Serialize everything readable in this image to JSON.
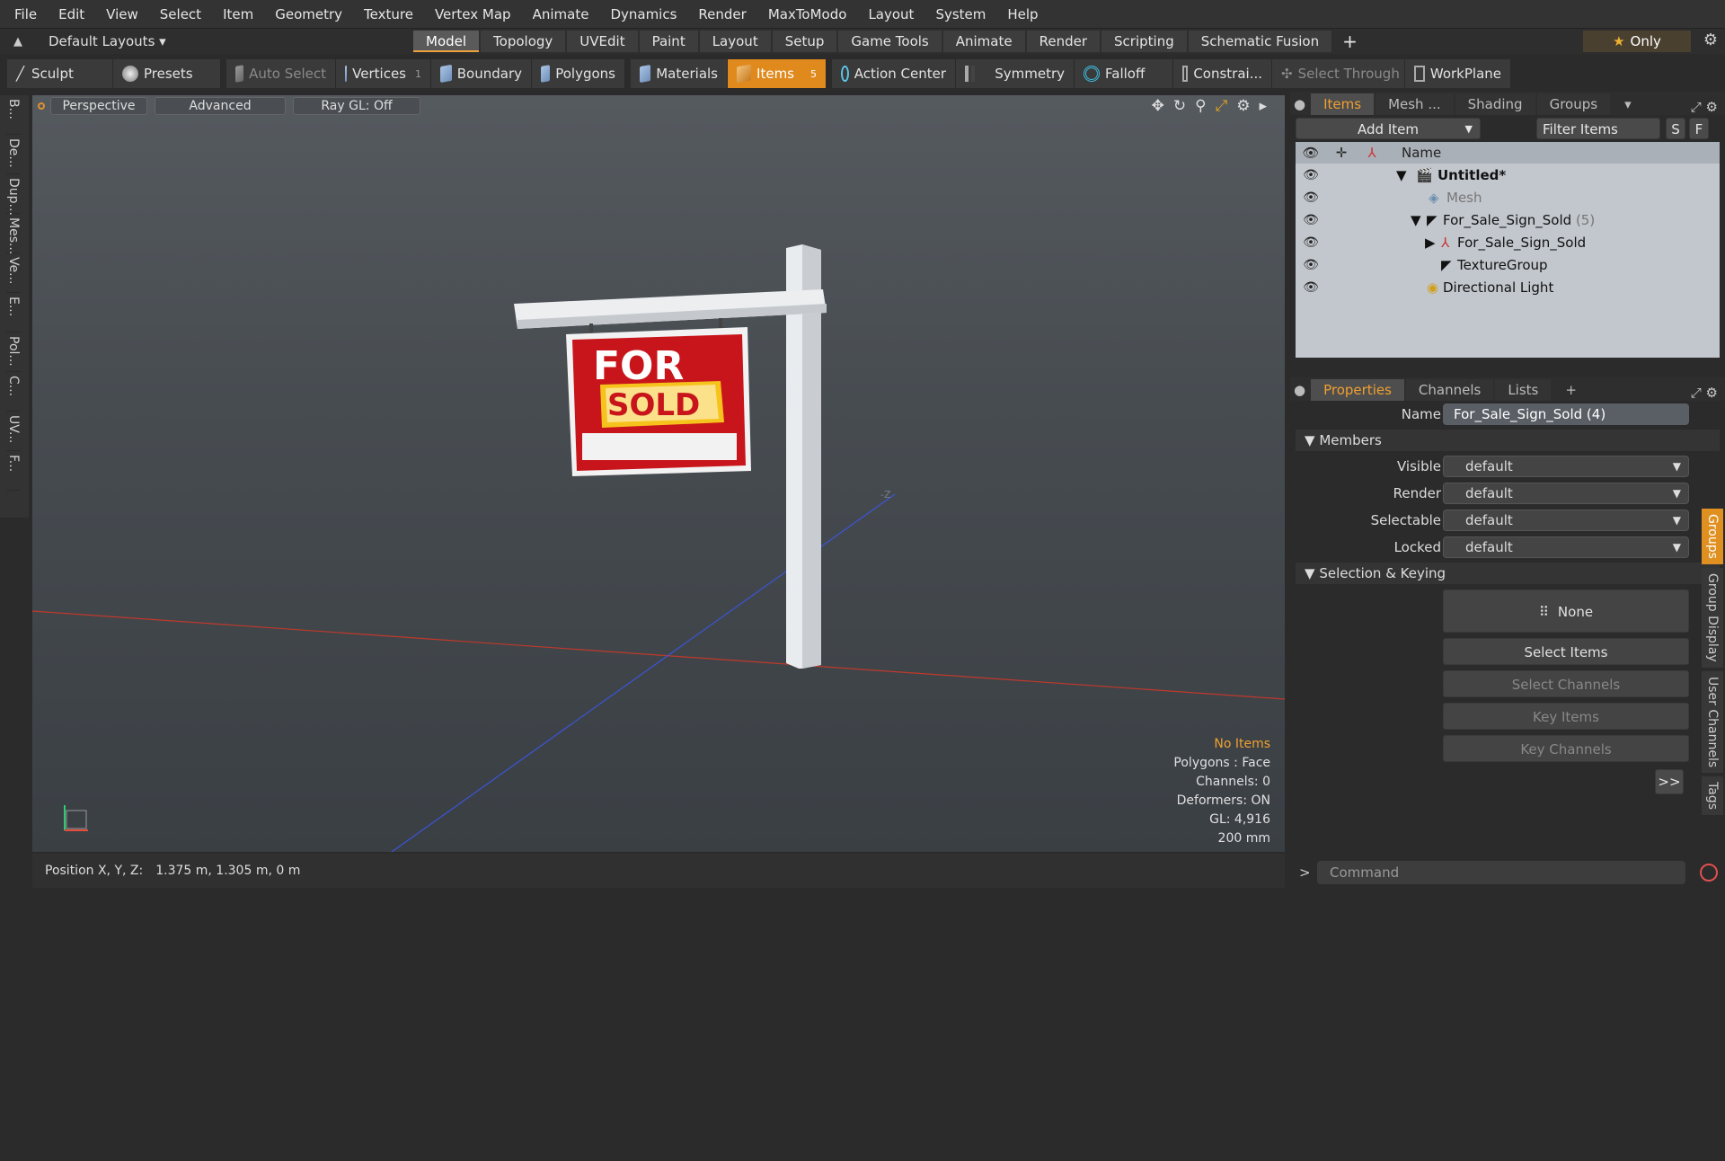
{
  "menu": [
    "File",
    "Edit",
    "View",
    "Select",
    "Item",
    "Geometry",
    "Texture",
    "Vertex Map",
    "Animate",
    "Dynamics",
    "Render",
    "MaxToModo",
    "Layout",
    "System",
    "Help"
  ],
  "layout": {
    "default_layouts": "Default Layouts ▾",
    "tabs": [
      "Model",
      "Topology",
      "UVEdit",
      "Paint",
      "Layout",
      "Setup",
      "Game Tools",
      "Animate",
      "Render",
      "Scripting",
      "Schematic Fusion"
    ],
    "active_tab": "Model",
    "only_label": "Only"
  },
  "toolbar": {
    "sculpt": "Sculpt",
    "presets": "Presets",
    "auto_select": "Auto Select",
    "vertices": "Vertices",
    "vertices_count": "1",
    "boundary": "Boundary",
    "polygons": "Polygons",
    "materials": "Materials",
    "items": "Items",
    "items_count": "5",
    "action_center": "Action Center",
    "symmetry": "Symmetry",
    "falloff": "Falloff",
    "constraints": "Constrai...",
    "select_through": "Select Through",
    "workplane": "WorkPlane"
  },
  "left_tabs": [
    "B...",
    "De...",
    "Dup...",
    "Mes...",
    "Ve...",
    "E...",
    "Pol...",
    "C...",
    "UV...",
    "F..."
  ],
  "viewport": {
    "perspective": "Perspective",
    "advanced": "Advanced",
    "raygl": "Ray GL: Off",
    "sign_top": "FOR",
    "sign_sold": "SOLD",
    "axis_label": "-Z",
    "stats": {
      "no_items": "No Items",
      "polygons": "Polygons : Face",
      "channels": "Channels: 0",
      "deformers": "Deformers: ON",
      "gl": "GL: 4,916",
      "size": "200 mm"
    }
  },
  "status": {
    "label": "Position X, Y, Z:",
    "value": "1.375 m, 1.305 m, 0 m"
  },
  "items_panel": {
    "tabs": [
      "Items",
      "Mesh ...",
      "Shading",
      "Groups"
    ],
    "add_item": "Add Item",
    "filter": "Filter Items",
    "s_btn": "S",
    "f_btn": "F",
    "name_col": "Name",
    "tree": [
      {
        "label": "Untitled*",
        "count": ""
      },
      {
        "label": "Mesh",
        "count": ""
      },
      {
        "label": "For_Sale_Sign_Sold",
        "count": "(5)"
      },
      {
        "label": "For_Sale_Sign_Sold",
        "count": ""
      },
      {
        "label": "TextureGroup",
        "count": ""
      },
      {
        "label": "Directional Light",
        "count": ""
      }
    ]
  },
  "properties": {
    "tabs": [
      "Properties",
      "Channels",
      "Lists"
    ],
    "name_label": "Name",
    "name_value": "For_Sale_Sign_Sold (4)",
    "members": "Members",
    "fields": [
      {
        "label": "Visible",
        "value": "default"
      },
      {
        "label": "Render",
        "value": "default"
      },
      {
        "label": "Selectable",
        "value": "default"
      },
      {
        "label": "Locked",
        "value": "default"
      }
    ],
    "selection_keying": "Selection & Keying",
    "none": "None",
    "select_items": "Select Items",
    "select_channels": "Select Channels",
    "key_items": "Key Items",
    "key_channels": "Key Channels",
    "more": ">>",
    "side_tabs": [
      "Groups",
      "Group Display",
      "User Channels",
      "Tags"
    ]
  },
  "command": {
    "placeholder": "Command"
  }
}
